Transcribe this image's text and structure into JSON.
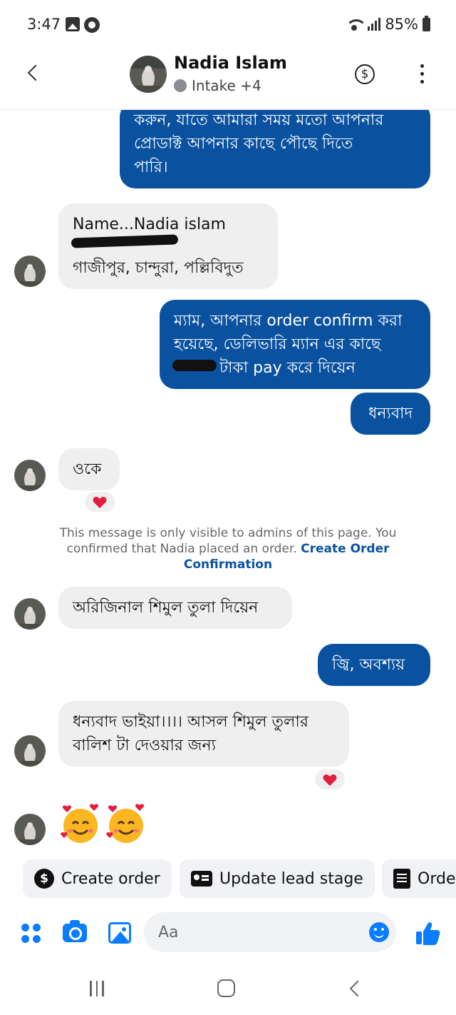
{
  "status_bar": {
    "time": "3:47",
    "battery": "85%"
  },
  "header": {
    "contact_name": "Nadia Islam",
    "subtitle": "Intake +4"
  },
  "messages": [
    {
      "direction": "out",
      "lines": [
        "করুন, যাতে আমারা সময় মতো আপনার",
        "প্রোডাক্ট আপনার কাছে পৌছে দিতে",
        "পারি।"
      ]
    },
    {
      "direction": "in",
      "lines": [
        "Name...Nadia islam",
        "",
        "গাজীপুর, চান্দুরা, পল্লিবিদুত"
      ]
    },
    {
      "direction": "out",
      "lines": [
        "ম্যাম, আপনার order confirm করা",
        "হয়েছে, ডেলিভারি ম্যান এর কাছে",
        "টাকা pay করে দিয়েন"
      ]
    },
    {
      "direction": "out",
      "lines": [
        "ধন্যবাদ"
      ]
    },
    {
      "direction": "in",
      "lines": [
        "ওকে"
      ],
      "reaction": "❤️"
    },
    {
      "direction": "in",
      "lines": [
        "অরিজিনাল শিমুল তুলা দিয়েন"
      ]
    },
    {
      "direction": "out",
      "lines": [
        "জ্বি, অবশ্যয়"
      ]
    },
    {
      "direction": "in",
      "lines": [
        "ধন্যবাদ ভাইয়া।।।। আসল শিমুল তুলার",
        "বালিশ টা দেওয়ার জন্য"
      ],
      "reaction": "❤️"
    },
    {
      "direction": "in",
      "emoji": [
        "🥰",
        "🥰"
      ]
    }
  ],
  "notice": {
    "text": "This message is only visible to admins of this page. You confirmed that Nadia placed an order. ",
    "link": "Create Order Confirmation"
  },
  "quick_actions": [
    {
      "label": "Create order",
      "icon": "dollar-icon"
    },
    {
      "label": "Update lead stage",
      "icon": "id-card-icon"
    },
    {
      "label": "Orde",
      "icon": "document-icon"
    }
  ],
  "composer": {
    "placeholder": "Aa"
  },
  "colors": {
    "outgoing_bubble": "#0a52a0",
    "incoming_bubble": "#efefef",
    "accent": "#0a7cff"
  }
}
